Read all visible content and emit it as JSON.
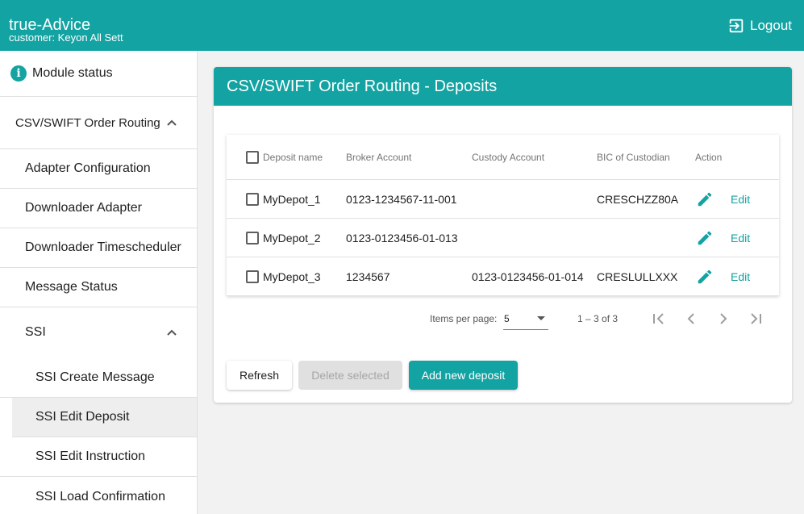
{
  "header": {
    "app_title": "true-Advice",
    "customer": "customer: Keyon All Sett",
    "logout_label": "Logout",
    "logout_icon": "logout-icon"
  },
  "sidebar": {
    "module_status": "Module status",
    "csv_swift": "CSV/SWIFT Order Routing",
    "items": [
      "Adapter Configuration",
      "Downloader Adapter",
      "Downloader Timescheduler",
      "Message Status"
    ],
    "ssi": "SSI",
    "ssi_items": [
      "SSI Create Message",
      "SSI Edit Deposit",
      "SSI Edit Instruction",
      "SSI Load Confirmation"
    ],
    "selected_item": "SSI Edit Deposit"
  },
  "card": {
    "title": "CSV/SWIFT Order Routing - Deposits"
  },
  "table": {
    "columns": [
      "Deposit name",
      "Broker Account",
      "Custody Account",
      "BIC of Custodian",
      "Action"
    ],
    "rows": [
      {
        "name": "MyDepot_1",
        "broker": "0123-1234567-11-001",
        "custody": "",
        "bic": "CRESCHZZ80A",
        "action": "Edit"
      },
      {
        "name": "MyDepot_2",
        "broker": "0123-0123456-01-013",
        "custody": "",
        "bic": "",
        "action": "Edit"
      },
      {
        "name": "MyDepot_3",
        "broker": "1234567",
        "custody": "0123-0123456-01-014",
        "bic": "CRESLULLXXX",
        "action": "Edit"
      }
    ]
  },
  "paginator": {
    "items_per_page_label": "Items per page:",
    "page_size": "5",
    "range": "1 – 3 of 3"
  },
  "buttons": {
    "refresh": "Refresh",
    "delete_selected": "Delete selected",
    "add_new": "Add new deposit"
  },
  "colors": {
    "accent": "#13a3a3",
    "selected_bg": "#eeeeee"
  }
}
